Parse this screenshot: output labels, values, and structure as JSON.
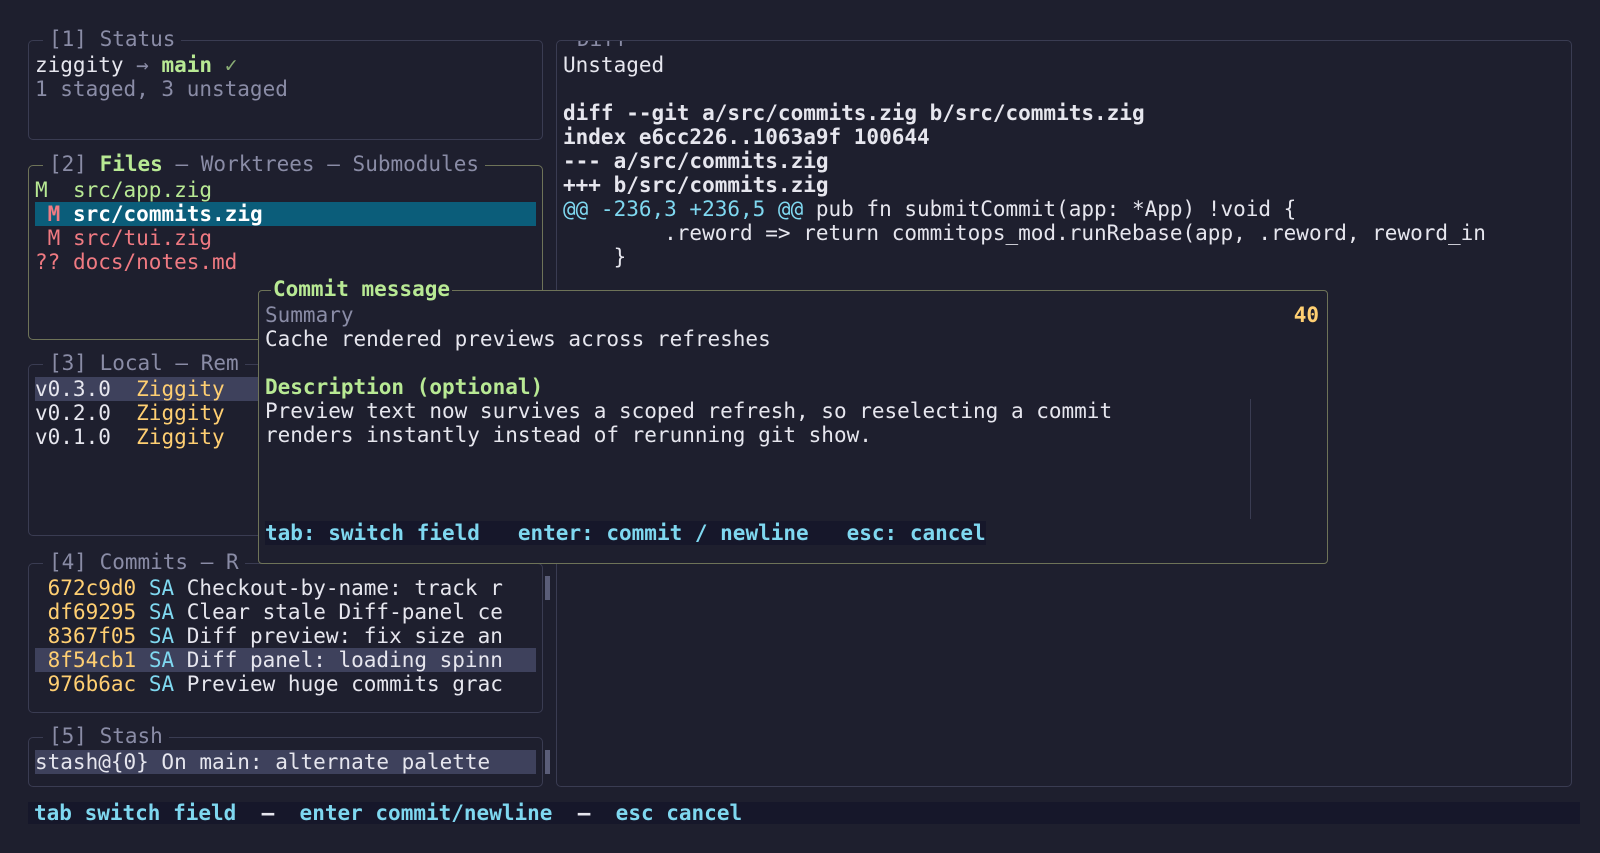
{
  "status": {
    "title": "[1] Status",
    "repo": "ziggity",
    "arrow": "→",
    "branch": "main",
    "check": "✓",
    "summary": "1 staged, 3 unstaged"
  },
  "files": {
    "title_num": "[2]",
    "tab_active": "Files",
    "sep1": "–",
    "tab2": "Worktrees",
    "sep2": "–",
    "tab3": "Submodules",
    "rows": [
      {
        "status": "M",
        "path": "src/app.zig"
      },
      {
        "status": "M",
        "path": "src/commits.zig"
      },
      {
        "status": "M",
        "path": "src/tui.zig"
      },
      {
        "status": "??",
        "path": "docs/notes.md"
      }
    ]
  },
  "branches": {
    "title": "[3] Local – Rem",
    "rows": [
      {
        "tag": "v0.3.0",
        "name": "Ziggity"
      },
      {
        "tag": "v0.2.0",
        "name": "Ziggity"
      },
      {
        "tag": "v0.1.0",
        "name": "Ziggity"
      }
    ]
  },
  "commits": {
    "title": "[4] Commits – R",
    "rows": [
      {
        "hash": "672c9d0",
        "author": "SA",
        "msg": "Checkout-by-name: track r"
      },
      {
        "hash": "df69295",
        "author": "SA",
        "msg": "Clear stale Diff-panel ce"
      },
      {
        "hash": "8367f05",
        "author": "SA",
        "msg": "Diff preview: fix size an"
      },
      {
        "hash": "8f54cb1",
        "author": "SA",
        "msg": "Diff panel: loading spinn"
      },
      {
        "hash": "976b6ac",
        "author": "SA",
        "msg": "Preview huge commits grac"
      }
    ]
  },
  "stash": {
    "title": "[5] Stash",
    "rows": [
      {
        "text": "stash@{0} On main: alternate palette"
      }
    ]
  },
  "diff": {
    "title": "Diff",
    "section": "Unstaged",
    "header1": "diff --git a/src/commits.zig b/src/commits.zig",
    "header2": "index e6cc226..1063a9f 100644",
    "header3": "--- a/src/commits.zig",
    "header4": "+++ b/src/commits.zig",
    "hunk_marker": "@@ -236,3 +236,5 @@",
    "hunk_context": " pub fn submitCommit(app: *App) !void {",
    "code1": "        .reword => return commitops_mod.runRebase(app, .reword, reword_in",
    "code2": "    }"
  },
  "modal": {
    "title": "Commit message",
    "summary_label": "Summary",
    "char_count": "40",
    "summary_value": "Cache rendered previews across refreshes",
    "description_label": "Description (optional)",
    "description_lines": [
      "Preview text now survives a scoped refresh, so reselecting a commit",
      "renders instantly instead of rerunning git show."
    ],
    "hint_tab": "tab: switch field",
    "hint_enter": "enter: commit / newline",
    "hint_esc": "esc: cancel"
  },
  "footer": {
    "hint_tab": "tab switch field",
    "sep1": "–",
    "hint_enter": "enter commit/newline",
    "sep2": "–",
    "hint_esc": "esc cancel"
  },
  "colors": {
    "background": "#1e1f2e",
    "accent_green": "#b8e994",
    "accent_yellow": "#ffcf72",
    "accent_red": "#f07a82",
    "accent_cyan": "#7fd8f0",
    "selection": "#0b5d7a"
  }
}
